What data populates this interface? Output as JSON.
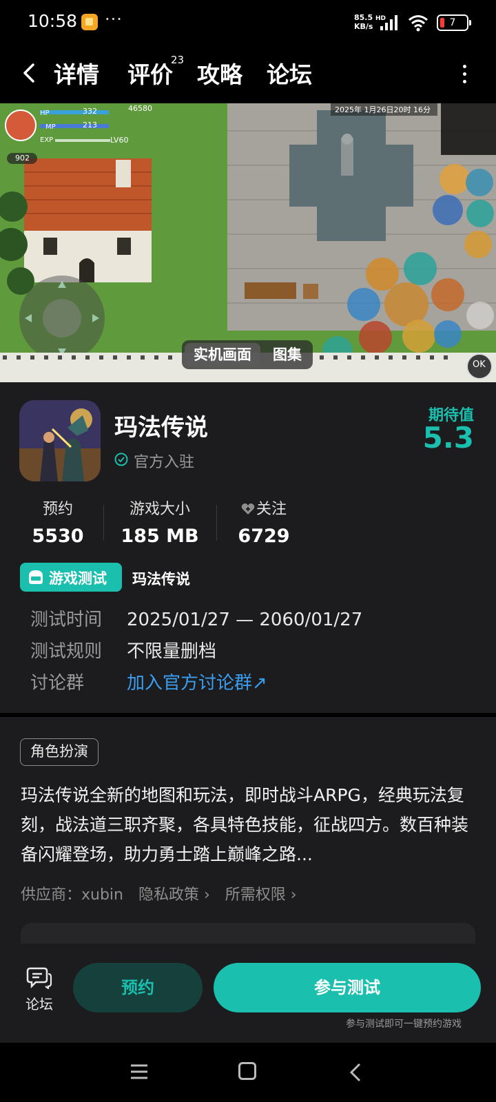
{
  "status_bar": {
    "time": "10:58",
    "more": "···",
    "net_speed_value": "85.5",
    "net_speed_unit": "KB/s",
    "net_type": "HD",
    "battery": "7",
    "battery_color": "#ff3b30"
  },
  "nav": {
    "tabs": [
      {
        "label": "详情",
        "active": true
      },
      {
        "label": "评价",
        "badge": "23"
      },
      {
        "label": "攻略"
      },
      {
        "label": "论坛"
      }
    ],
    "back_icon": "back-chevron-icon",
    "more_icon": "more-vertical-icon"
  },
  "media": {
    "toggle": {
      "live_label": "实机画面",
      "gallery_label": "图集"
    },
    "scene": {
      "hp_label": "HP",
      "hp_value": "332",
      "mp_label": "MP",
      "mp_value": "213",
      "exp_label": "EXP",
      "level": "LV60",
      "gold": "46580",
      "player_badge": "902",
      "timestamp": "2025年 1月26日20时 16分",
      "ok_label": "OK"
    }
  },
  "game": {
    "title": "玛法传说",
    "verified_label": "官方入驻",
    "expect_label": "期待值",
    "expect_score": "5.3",
    "stats": {
      "reserve_label": "预约",
      "reserve_value": "5530",
      "size_label": "游戏大小",
      "size_value": "185 MB",
      "follow_label": "关注",
      "follow_value": "6729"
    },
    "test_badge_label": "游戏测试",
    "test_game_name": "玛法传说",
    "info": {
      "time_key": "测试时间",
      "time_val": "2025/01/27 — 2060/01/27",
      "rule_key": "测试规则",
      "rule_val": "不限量删档",
      "group_key": "讨论群",
      "group_val": "加入官方讨论群↗"
    },
    "genre": "角色扮演",
    "description": "玛法传说全新的地图和玩法，即时战斗ARPG，经典玩法复刻，战法道三职齐聚，各具特色技能，征战四方。数百种装备闪耀登场，助力勇士踏上巅峰之路...",
    "meta": {
      "supplier": "供应商：xubin",
      "privacy": "隐私政策 ›",
      "permissions": "所需权限 ›"
    }
  },
  "action_bar": {
    "forum_label": "论坛",
    "reserve_label": "预约",
    "join_label": "参与测试",
    "join_hint": "参与测试即可一键预约游戏"
  },
  "colors": {
    "accent": "#1bbfae",
    "link": "#3a9ef0",
    "panel_bg": "#1c1c1e"
  }
}
